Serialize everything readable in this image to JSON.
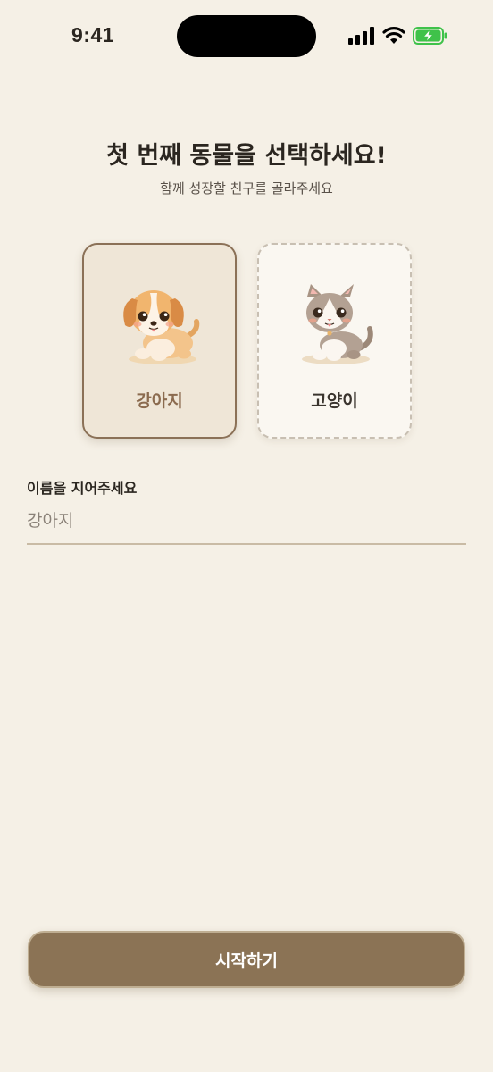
{
  "status_bar": {
    "time": "9:41",
    "icons": [
      "signal-icon",
      "wifi-icon",
      "battery-charging-icon"
    ],
    "battery_color": "#3fc24a"
  },
  "header": {
    "title": "첫 번째 동물을 선택하세요!",
    "subtitle": "함께 성장할 친구를 골라주세요"
  },
  "animals": [
    {
      "label": "강아지",
      "icon": "puppy-illustration",
      "selected": true
    },
    {
      "label": "고양이",
      "icon": "kitten-illustration",
      "selected": false
    }
  ],
  "name_field": {
    "label": "이름을 지어주세요",
    "placeholder": "강아지",
    "value": ""
  },
  "start_button": {
    "label": "시작하기"
  },
  "colors": {
    "background": "#f5f0e6",
    "accent": "#8b7355",
    "selected_border": "#8b7157"
  }
}
